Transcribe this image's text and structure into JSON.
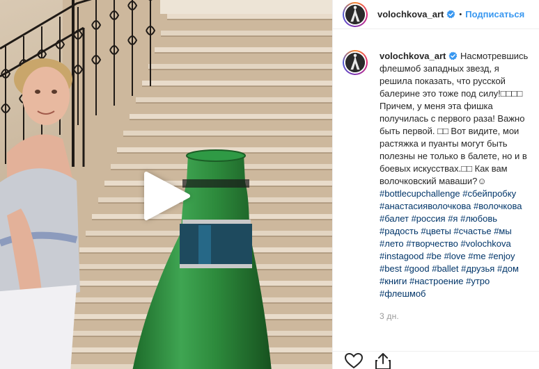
{
  "post": {
    "username": "volochkova_art",
    "follow_label": "Подписаться",
    "separator": "•",
    "caption_text": "Насмотревшись флешмоб западных звезд, я решила показать, что русской балерине это тоже под силу!□□□□ Причем, у меня эта фишка получилась с первого раза! Важно быть первой. □□ Вот видите, мои растяжка и пуанты могут быть полезны не только в балете, но и в боевых искусствах.□□ Как вам волочковский маваши?☺ ",
    "hashtags": [
      "#bottlecupchallenge",
      "#сбейпробку",
      "#анастасияволочкова",
      "#волочкова",
      "#балет",
      "#россия",
      "#я",
      "#любовь",
      "#радость",
      "#цветы",
      "#счастье",
      "#мы",
      "#лето",
      "#творчество",
      "#volochkova",
      "#instagood",
      "#be",
      "#love",
      "#me",
      "#enjoy",
      "#best",
      "#good",
      "#ballet",
      "#друзья",
      "#дом",
      "#книги",
      "#настроение",
      "#утро",
      "#флешмоб"
    ],
    "timestamp": "3 дн."
  },
  "icons": {
    "verified": "verified-badge-icon",
    "play": "play-icon",
    "like": "heart-icon",
    "share": "share-icon"
  },
  "colors": {
    "link": "#3897f0",
    "hashtag": "#003569",
    "verified": "#3897f0",
    "muted": "#999999"
  }
}
